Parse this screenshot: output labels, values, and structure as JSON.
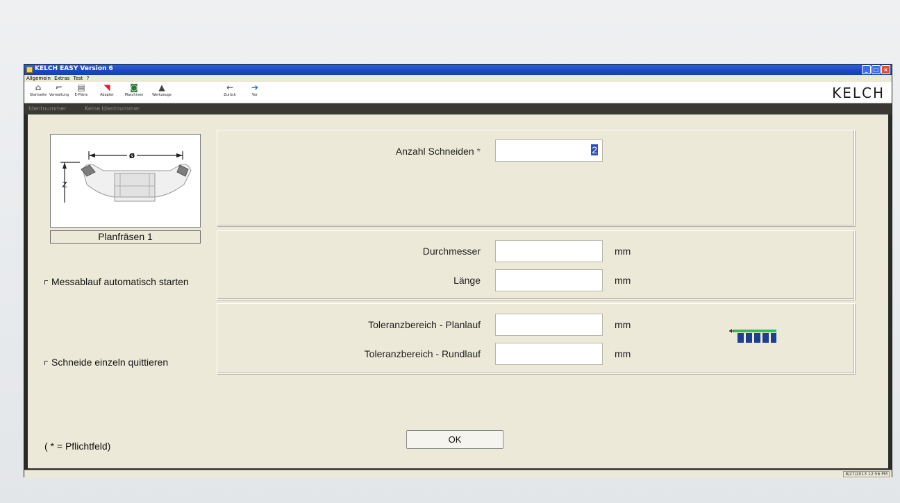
{
  "window": {
    "title": "KELCH EASY Version 6"
  },
  "menu": [
    "Allgemein",
    "Extras",
    "Test",
    "?"
  ],
  "toolbar": {
    "items": [
      {
        "label": "Startseite",
        "icon": "home-icon"
      },
      {
        "label": "Verwaltung",
        "icon": "folder-icon"
      },
      {
        "label": "E-Pläne",
        "icon": "plan-icon"
      },
      {
        "label": "Adapter",
        "icon": "adapter-icon"
      },
      {
        "label": "Maschinen",
        "icon": "machine-icon"
      },
      {
        "label": "Werkzeuge",
        "icon": "tools-icon"
      },
      {
        "label": "Zurück",
        "icon": "back-arrow-icon"
      },
      {
        "label": "Vor",
        "icon": "forward-arrow-icon"
      }
    ],
    "logo": "KELCH"
  },
  "idbar": {
    "label": "Identnummer",
    "value": "Keine Identnummer"
  },
  "tool": {
    "caption": "Planfräsen 1",
    "diameter_symbol": "ø",
    "z_label": "Z"
  },
  "options": {
    "auto_start": "Messablauf automatisch starten",
    "confirm_each": "Schneide einzeln quittieren"
  },
  "form": {
    "anzahl_label": "Anzahl Schneiden",
    "required_marker": "*",
    "anzahl_value": "2",
    "durchmesser_label": "Durchmesser",
    "laenge_label": "Länge",
    "planlauf_label": "Toleranzbereich - Planlauf",
    "rundlauf_label": "Toleranzbereich - Rundlauf",
    "unit": "mm"
  },
  "ok_label": "OK",
  "required_note": "( * = Pflichtfeld)",
  "status": {
    "datetime": "8/27/2013 12:56 PM"
  }
}
